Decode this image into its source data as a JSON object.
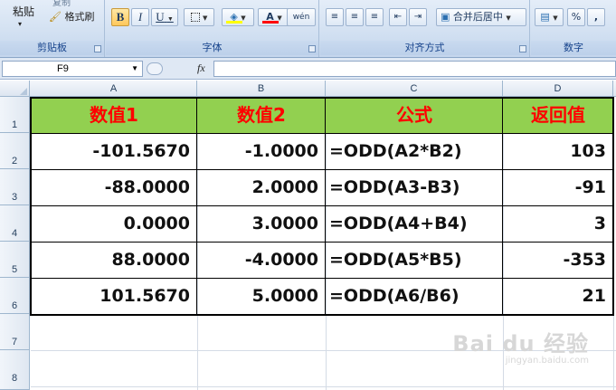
{
  "ribbon": {
    "clipboard": {
      "paste_label": "粘贴",
      "top_cut_label": "复制",
      "format_painter_label": "格式刷",
      "group_label": "剪贴板"
    },
    "font": {
      "bold": "B",
      "italic": "I",
      "underline": "U",
      "font_color_glyph": "A",
      "phonetic_glyph": "wén",
      "group_label": "字体"
    },
    "alignment": {
      "merge_label": "合并后居中",
      "group_label": "对齐方式"
    },
    "number": {
      "percent_label": "%",
      "comma_label": ",",
      "group_label": "数字"
    }
  },
  "formula_bar": {
    "name_box": "F9",
    "fx_label": "fx",
    "formula": ""
  },
  "columns": [
    "A",
    "B",
    "C",
    "D"
  ],
  "rows": [
    "1",
    "2",
    "3",
    "4",
    "5",
    "6",
    "7",
    "8"
  ],
  "table": {
    "headers": [
      "数值1",
      "数值2",
      "公式",
      "返回值"
    ],
    "rows": [
      [
        "-101.5670",
        "-1.0000",
        "=ODD(A2*B2)",
        "103"
      ],
      [
        "-88.0000",
        "2.0000",
        "=ODD(A3-B3)",
        "-91"
      ],
      [
        "0.0000",
        "3.0000",
        "=ODD(A4+B4)",
        "3"
      ],
      [
        "88.0000",
        "-4.0000",
        "=ODD(A5*B5)",
        "-353"
      ],
      [
        "101.5670",
        "5.0000",
        "=ODD(A6/B6)",
        "21"
      ]
    ]
  },
  "colors": {
    "header_fill": "#92d050",
    "header_text": "#ff0000",
    "ribbon_bg": "#d3e1f2"
  },
  "watermark": {
    "main": "Bai du 经验",
    "sub": "jingyan.baidu.com"
  }
}
